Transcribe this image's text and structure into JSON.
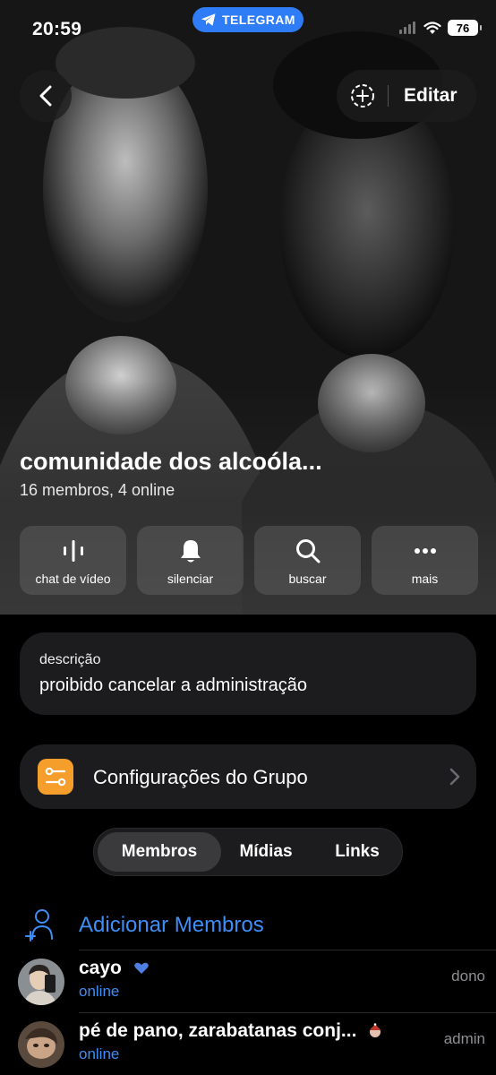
{
  "status_bar": {
    "time": "20:59",
    "app_pill": "TELEGRAM",
    "battery": "76"
  },
  "header": {
    "edit_label": "Editar"
  },
  "group": {
    "name": "comunidade dos alcoóla...",
    "subtitle": "16 membros, 4 online"
  },
  "actions": [
    {
      "label": "chat de vídeo",
      "icon": "voice-chat-icon"
    },
    {
      "label": "silenciar",
      "icon": "bell-icon"
    },
    {
      "label": "buscar",
      "icon": "search-icon"
    },
    {
      "label": "mais",
      "icon": "more-icon"
    }
  ],
  "description": {
    "label": "descrição",
    "text": "proibido cancelar a administração"
  },
  "settings": {
    "label": "Configurações do Grupo",
    "icon_color": "#f59e2c"
  },
  "tabs": [
    {
      "label": "Membros",
      "active": true
    },
    {
      "label": "Mídias",
      "active": false
    },
    {
      "label": "Links",
      "active": false
    }
  ],
  "add_members": {
    "label": "Adicionar Membros"
  },
  "members": [
    {
      "name": "cayo",
      "status": "online",
      "role": "dono"
    },
    {
      "name": "pé de pano, zarabatanas conj...",
      "status": "online",
      "role": "admin"
    }
  ],
  "colors": {
    "accent": "#3e8ef7",
    "telegram": "#2f7df6",
    "card": "#1c1c1e"
  }
}
